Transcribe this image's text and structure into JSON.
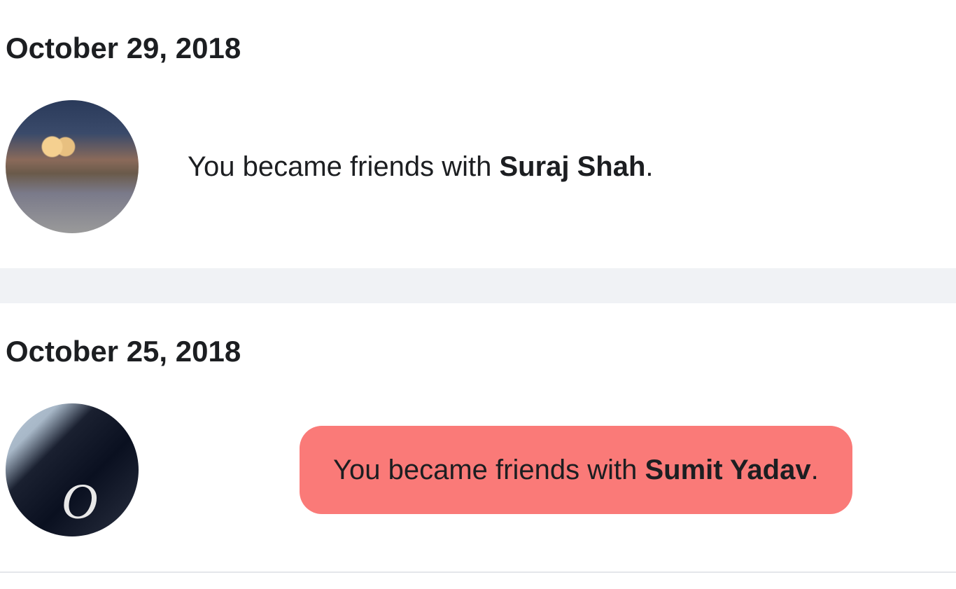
{
  "entries": [
    {
      "date": "October 29, 2018",
      "prefix": "You",
      "middle": " became friends with ",
      "friend_name": "Suraj Shah",
      "suffix": ".",
      "highlighted": false
    },
    {
      "date": "October 25, 2018",
      "prefix": "You",
      "middle": " became friends with ",
      "friend_name": "Sumit Yadav",
      "suffix": ".",
      "highlighted": true
    }
  ]
}
